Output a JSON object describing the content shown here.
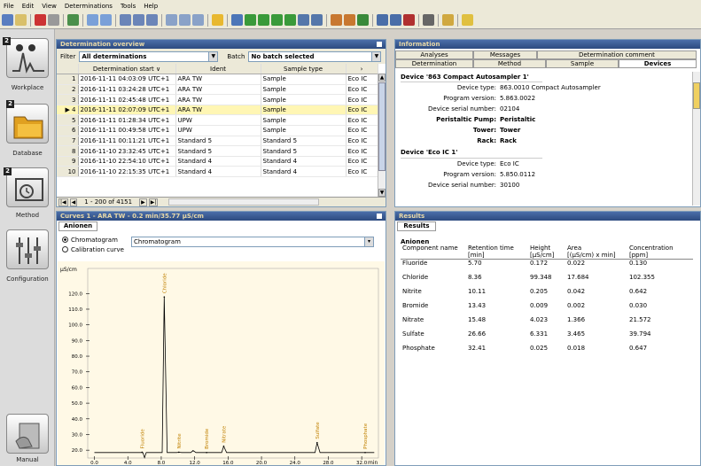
{
  "menu": [
    "File",
    "Edit",
    "View",
    "Determinations",
    "Tools",
    "Help"
  ],
  "nav": [
    {
      "label": "Workplace",
      "badge": "2"
    },
    {
      "label": "Database",
      "badge": "2"
    },
    {
      "label": "Method",
      "badge": "2"
    },
    {
      "label": "Configuration",
      "badge": ""
    },
    {
      "label": "Manual",
      "badge": ""
    }
  ],
  "overview": {
    "title": "Determination overview",
    "filter_label": "Filter",
    "filter_value": "All determinations",
    "batch_label": "Batch",
    "batch_value": "No batch selected",
    "columns": [
      "Determination start",
      "Ident",
      "Sample type"
    ],
    "col_extra": "›",
    "rows": [
      {
        "n": "1",
        "start": "2016-11-11 04:03:09 UTC+1",
        "ident": "ARA TW",
        "stype": "Sample",
        "ext": "Eco IC"
      },
      {
        "n": "2",
        "start": "2016-11-11 03:24:28 UTC+1",
        "ident": "ARA TW",
        "stype": "Sample",
        "ext": "Eco IC"
      },
      {
        "n": "3",
        "start": "2016-11-11 02:45:48 UTC+1",
        "ident": "ARA TW",
        "stype": "Sample",
        "ext": "Eco IC"
      },
      {
        "n": "4",
        "start": "2016-11-11 02:07:09 UTC+1",
        "ident": "ARA TW",
        "stype": "Sample",
        "ext": "Eco IC"
      },
      {
        "n": "5",
        "start": "2016-11-11 01:28:34 UTC+1",
        "ident": "UPW",
        "stype": "Sample",
        "ext": "Eco IC"
      },
      {
        "n": "6",
        "start": "2016-11-11 00:49:58 UTC+1",
        "ident": "UPW",
        "stype": "Sample",
        "ext": "Eco IC"
      },
      {
        "n": "7",
        "start": "2016-11-11 00:11:21 UTC+1",
        "ident": "Standard 5",
        "stype": "Standard 5",
        "ext": "Eco IC"
      },
      {
        "n": "8",
        "start": "2016-11-10 23:32:45 UTC+1",
        "ident": "Standard 5",
        "stype": "Standard 5",
        "ext": "Eco IC"
      },
      {
        "n": "9",
        "start": "2016-11-10 22:54:10 UTC+1",
        "ident": "Standard 4",
        "stype": "Standard 4",
        "ext": "Eco IC"
      },
      {
        "n": "10",
        "start": "2016-11-10 22:15:35 UTC+1",
        "ident": "Standard 4",
        "stype": "Standard 4",
        "ext": "Eco IC"
      }
    ],
    "pager": "1 - 200 of 4151"
  },
  "information": {
    "title": "Information",
    "tabs_top": [
      "Analyses",
      "Messages",
      "Determination comment"
    ],
    "tabs_bottom": [
      "Determination",
      "Method",
      "Sample",
      "Devices"
    ],
    "device1": {
      "header": "Device '863 Compact Autosampler 1'",
      "type_k": "Device type:",
      "type_v": "863.0010 Compact Autosampler",
      "prog_k": "Program version:",
      "prog_v": "5.863.0022",
      "serial_k": "Device serial number:",
      "serial_v": "02104",
      "pump_k": "Peristaltic Pump:",
      "pump_v": "Peristaltic",
      "tower_k": "Tower:",
      "tower_v": "Tower",
      "rack_k": "Rack:",
      "rack_v": "Rack"
    },
    "device2": {
      "header": "Device 'Eco IC 1'",
      "type_k": "Device type:",
      "type_v": "Eco IC",
      "prog_k": "Program version:",
      "prog_v": "5.850.0112",
      "serial_k": "Device serial number:",
      "serial_v": "30100"
    }
  },
  "curves": {
    "title": "Curves 1 - ARA TW - 0.2 min/35.77 µS/cm",
    "tab": "Anionen",
    "radio1": "Chromatogram",
    "radio2": "Calibration curve",
    "select": "Chromatogram"
  },
  "chart_data": {
    "type": "line",
    "ylabel": "µS/cm",
    "xlabel": "min",
    "xlim": [
      -0.8,
      34
    ],
    "ylim": [
      15,
      136
    ],
    "yticks": [
      20,
      30,
      40,
      50,
      60,
      70,
      80,
      90,
      100,
      110,
      120
    ],
    "xticks": [
      0,
      4,
      8,
      12,
      16,
      20,
      24,
      28,
      32
    ],
    "ytick_labels": [
      "20.0",
      "30.0",
      "40.0",
      "50.0",
      "60.0",
      "70.0",
      "80.0",
      "90.0",
      "100.0",
      "110.0",
      "120.0"
    ],
    "xtick_labels": [
      "0.0",
      "4.0",
      "8.0",
      "12.0",
      "16.0",
      "20.0",
      "24.0",
      "28.0",
      "32.0"
    ],
    "baseline": 18.5,
    "peaks": [
      {
        "name": "Fluoride",
        "x": 5.7,
        "y": 18.7
      },
      {
        "name": "Chloride",
        "x": 8.36,
        "y": 117.8
      },
      {
        "name": "Nitrite",
        "x": 10.11,
        "y": 18.7
      },
      {
        "name": "Bromide",
        "x": 13.43,
        "y": 18.5
      },
      {
        "name": "Nitrate",
        "x": 15.48,
        "y": 22.5
      },
      {
        "name": "Sulfate",
        "x": 26.66,
        "y": 24.8
      },
      {
        "name": "Phosphate",
        "x": 32.41,
        "y": 18.5
      }
    ],
    "extra_blips": [
      {
        "x": 11.8,
        "y": 19.8
      }
    ],
    "line_color": "#000000",
    "label_color": "#c08000",
    "bg": "#fff9e6",
    "pre_peak": {
      "x": 6.0,
      "y": 15.2
    }
  },
  "results": {
    "title": "Results",
    "tab": "Results",
    "group": "Anionen",
    "columns": [
      "Component name",
      "Retention time",
      "Height",
      "Area",
      "Concentration"
    ],
    "units": [
      "",
      "[min]",
      "[µS/cm]",
      "[(µS/cm) x min]",
      "[ppm]"
    ],
    "rows": [
      {
        "name": "Fluoride",
        "rt": "5.70",
        "h": "0.172",
        "a": "0.022",
        "c": "0.130"
      },
      {
        "name": "Chloride",
        "rt": "8.36",
        "h": "99.348",
        "a": "17.684",
        "c": "102.355"
      },
      {
        "name": "Nitrite",
        "rt": "10.11",
        "h": "0.205",
        "a": "0.042",
        "c": "0.642"
      },
      {
        "name": "Bromide",
        "rt": "13.43",
        "h": "0.009",
        "a": "0.002",
        "c": "0.030"
      },
      {
        "name": "Nitrate",
        "rt": "15.48",
        "h": "4.023",
        "a": "1.366",
        "c": "21.572"
      },
      {
        "name": "Sulfate",
        "rt": "26.66",
        "h": "6.331",
        "a": "3.465",
        "c": "39.794"
      },
      {
        "name": "Phosphate",
        "rt": "32.41",
        "h": "0.025",
        "a": "0.018",
        "c": "0.647"
      }
    ]
  }
}
